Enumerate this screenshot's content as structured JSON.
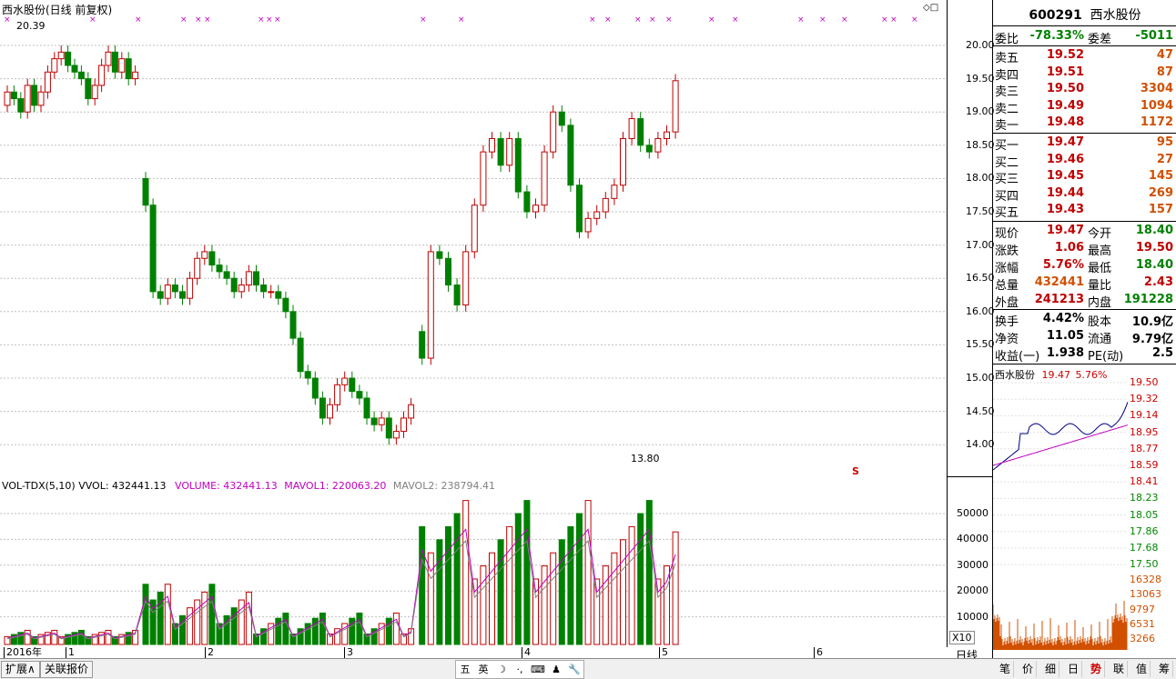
{
  "chart_title": "西水股份(日线 前复权)",
  "main_high_label": "20.39",
  "main_low_label": "13.80",
  "s_marker": "S",
  "price_axis": [
    "20.00",
    "19.50",
    "19.00",
    "18.50",
    "18.00",
    "17.50",
    "17.00",
    "16.50",
    "16.00",
    "15.50",
    "15.00",
    "14.50",
    "14.00"
  ],
  "vol_header": {
    "name": "VOL-TDX(5,10)",
    "vvol": "VVOL: 432441.13",
    "volume": "VOLUME: 432441.13",
    "mavol1": "MAVOL1: 220063.20",
    "mavol2": "MAVOL2: 238794.41"
  },
  "vol_axis": [
    "50000",
    "40000",
    "30000",
    "20000",
    "10000"
  ],
  "vol_scale": "X10",
  "x_axis_labels": [
    "2016年",
    "1",
    "2",
    "3",
    "4",
    "5",
    "6"
  ],
  "period_label": "日线",
  "colors": {
    "up": "#c00000",
    "down": "#008000",
    "ma1": "#c000c0",
    "ma2": "#808080",
    "grid": "#c0c0c0"
  },
  "quote": {
    "code": "600291",
    "name": "西水股份",
    "weibi_label": "委比",
    "weibi": "-78.33%",
    "weicha_label": "委差",
    "weicha": "-5011",
    "sell": [
      {
        "label": "卖五",
        "price": "19.52",
        "vol": "47"
      },
      {
        "label": "卖四",
        "price": "19.51",
        "vol": "87"
      },
      {
        "label": "卖三",
        "price": "19.50",
        "vol": "3304"
      },
      {
        "label": "卖二",
        "price": "19.49",
        "vol": "1094"
      },
      {
        "label": "卖一",
        "price": "19.48",
        "vol": "1172"
      }
    ],
    "buy": [
      {
        "label": "买一",
        "price": "19.47",
        "vol": "95"
      },
      {
        "label": "买二",
        "price": "19.46",
        "vol": "27"
      },
      {
        "label": "买三",
        "price": "19.45",
        "vol": "145"
      },
      {
        "label": "买四",
        "price": "19.44",
        "vol": "269"
      },
      {
        "label": "买五",
        "price": "19.43",
        "vol": "157"
      }
    ],
    "stats1": [
      {
        "l1": "现价",
        "v1": "19.47",
        "l2": "今开",
        "v2": "18.40"
      },
      {
        "l1": "涨跌",
        "v1": "1.06",
        "l2": "最高",
        "v2": "19.50"
      },
      {
        "l1": "涨幅",
        "v1": "5.76%",
        "l2": "最低",
        "v2": "18.40"
      },
      {
        "l1": "总量",
        "v1": "432441",
        "l2": "量比",
        "v2": "2.43"
      },
      {
        "l1": "外盘",
        "v1": "241213",
        "l2": "内盘",
        "v2": "191228"
      }
    ],
    "stats2": [
      {
        "l1": "换手",
        "v1": "4.42%",
        "l2": "股本",
        "v2": "10.9亿"
      },
      {
        "l1": "净资",
        "v1": "11.05",
        "l2": "流通",
        "v2": "9.79亿"
      },
      {
        "l1": "收益(一)",
        "v1": "1.938",
        "l2": "PE(动)",
        "v2": "2.5"
      }
    ]
  },
  "mini_chart": {
    "title": "西水股份",
    "price": "19.47",
    "pct": "5.76%",
    "price_axis": [
      "19.50",
      "19.32",
      "19.14",
      "18.95",
      "18.77",
      "18.59",
      "18.41",
      "18.23",
      "18.05",
      "17.86",
      "17.68",
      "17.50"
    ],
    "vol_axis": [
      "16328",
      "13063",
      "9797",
      "6531",
      "3266"
    ]
  },
  "bottom": {
    "expand": "扩展∧",
    "related": "关联报价",
    "tabs": [
      "笔",
      "价",
      "细",
      "日",
      "势",
      "联",
      "值",
      "筹"
    ],
    "active_tab": "势",
    "ime": [
      "五",
      "英",
      "☽",
      "·,",
      "⌨",
      "♟",
      "🔧"
    ]
  }
}
